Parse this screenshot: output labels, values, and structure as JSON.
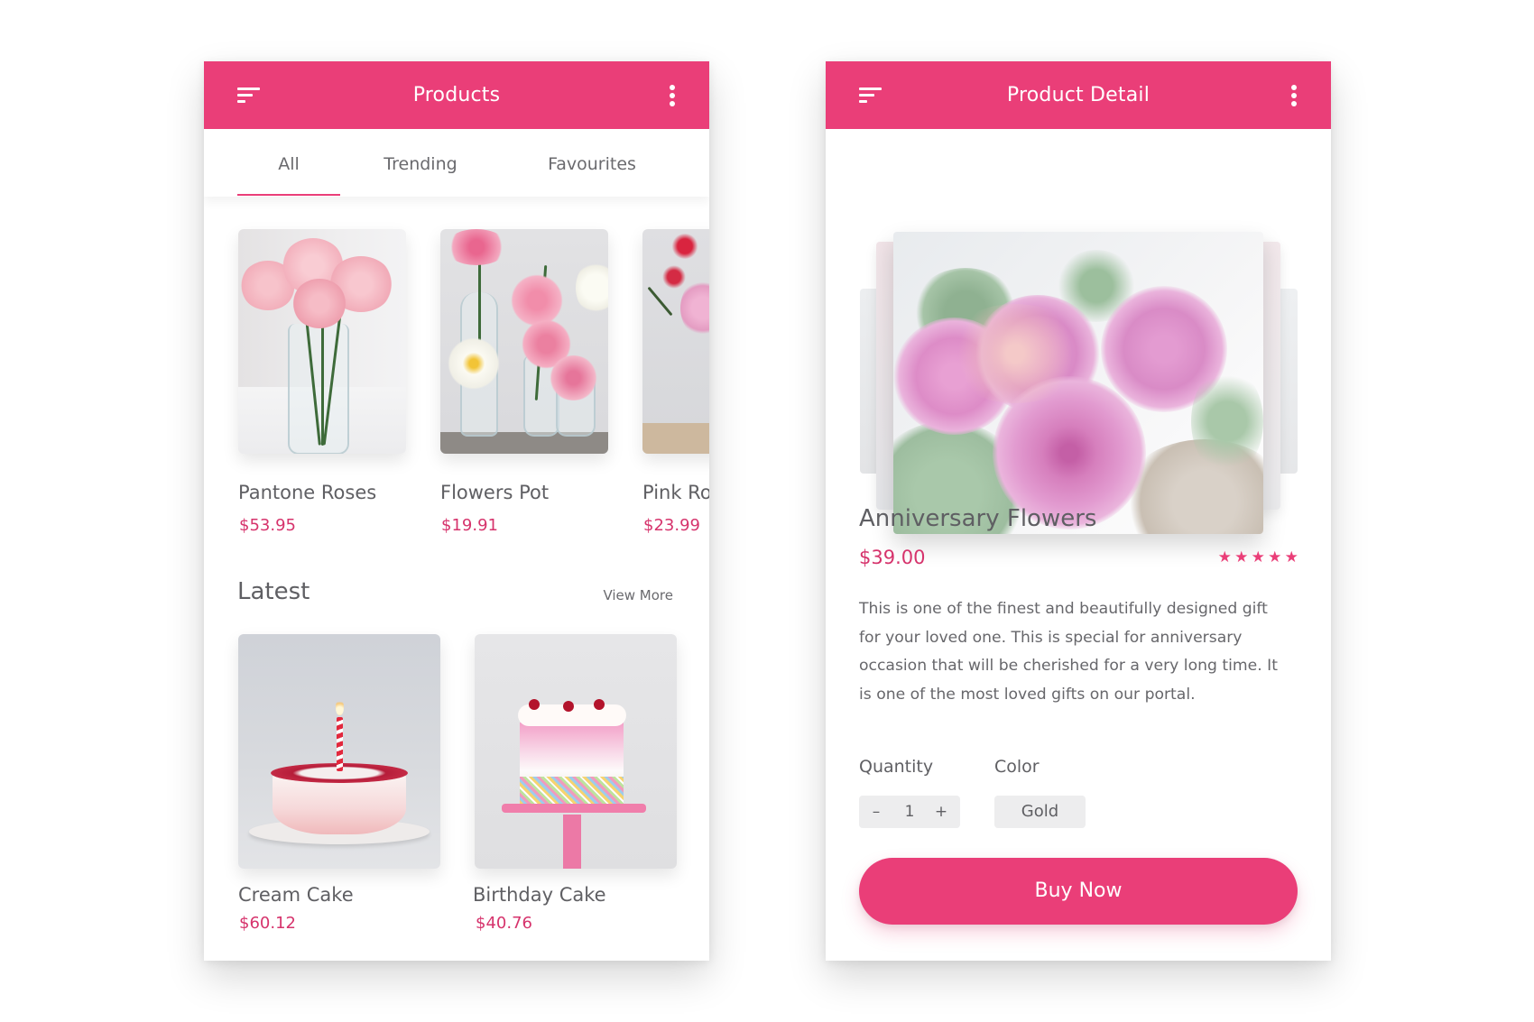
{
  "theme": {
    "accent": "#EA3E78",
    "price_color": "#D6336C"
  },
  "products_screen": {
    "title": "Products",
    "menu_icon": "sort-menu-icon",
    "more_icon": "more-vertical-icon",
    "tabs": [
      {
        "label": "All",
        "active": true
      },
      {
        "label": "Trending",
        "active": false
      },
      {
        "label": "Favourites",
        "active": false
      }
    ],
    "featured": [
      {
        "name": "Pantone Roses",
        "price": "$53.95",
        "image": "pink-carnations-in-vase"
      },
      {
        "name": "Flowers Pot",
        "price": "$19.91",
        "image": "lilies-and-dahlias-in-bottles"
      },
      {
        "name": "Pink Ro",
        "price": "$23.99",
        "image": "pink-roses-bouquet"
      }
    ],
    "latest": {
      "title": "Latest",
      "view_more": "View More",
      "items": [
        {
          "name": "Cream Cake",
          "price": "$60.12",
          "image": "cream-cake-with-candle"
        },
        {
          "name": "Birthday Cake",
          "price": "$40.76",
          "image": "pink-drip-birthday-cake"
        }
      ]
    }
  },
  "detail_screen": {
    "title": "Product Detail",
    "menu_icon": "sort-menu-icon",
    "more_icon": "more-vertical-icon",
    "product": {
      "name": "Anniversary Flowers",
      "price": "$39.00",
      "rating": 5,
      "rating_max": 5,
      "image": "pink-roses-bouquet",
      "description": "This is one of the finest and beautifully designed gift for your loved one. This is special for anniversary occasion that will be cherished for a very long time. It is one of the most loved gifts on our portal."
    },
    "quantity": {
      "label": "Quantity",
      "minus": "–",
      "value": "1",
      "plus": "+"
    },
    "color": {
      "label": "Color",
      "value": "Gold"
    },
    "buy_label": "Buy Now"
  }
}
